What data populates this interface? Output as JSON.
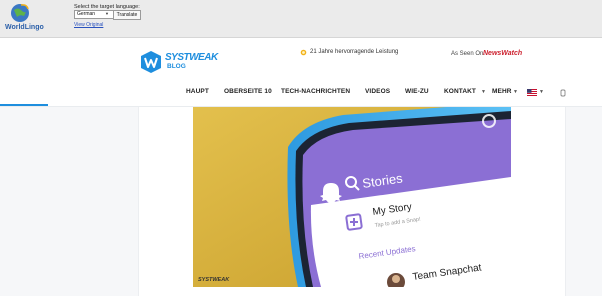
{
  "worldlingo": {
    "logo_text": "WorldLingo",
    "prompt": "Select the target language:",
    "language_selected": "German",
    "translate_label": "Translate",
    "view_original": "View Original"
  },
  "header": {
    "brand_name": "SYSTWEAK",
    "brand_sub": "BLOG",
    "award_text": "21 Jahre hervorragende Leistung",
    "as_seen": "As Seen On:",
    "newswatch": "NewsWatch"
  },
  "nav": {
    "items": [
      "HAUPT",
      "OBERSEITE 10",
      "TECH-NACHRICHTEN",
      "VIDEOS",
      "WIE-ZU",
      "KONTAKT",
      "MEHR"
    ]
  },
  "hero": {
    "stories_label": "Stories",
    "my_story": "My Story",
    "my_story_sub": "Tap to add a Snap!",
    "recent_updates": "Recent Updates",
    "team_snapchat": "Team Snapchat",
    "watermark": "SYSTWEAK"
  },
  "colors": {
    "brand_blue": "#1e8ede",
    "snap_purple": "#8b6fd4",
    "hero_yellow": "#d9b23c"
  }
}
